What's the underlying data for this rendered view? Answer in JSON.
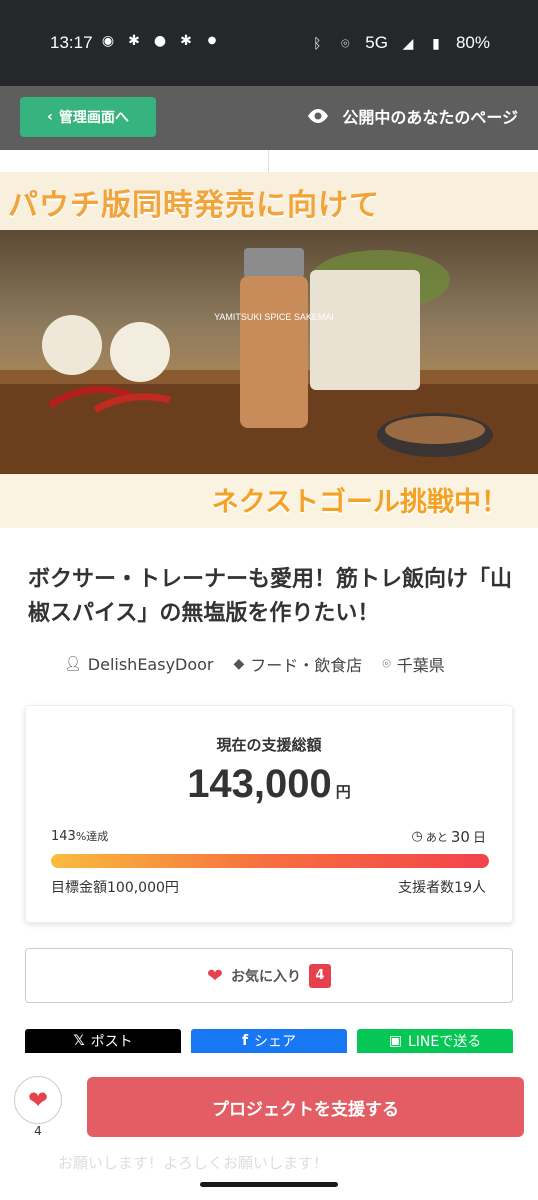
{
  "status_bar": {
    "time": "13:17",
    "network": "5G",
    "battery": "80%"
  },
  "header": {
    "admin_button": "管理画面へ",
    "public_page_link": "公開中のあなたのページ"
  },
  "hero": {
    "top_caption": "パウチ版同時発売に向けて",
    "bottom_caption": "ネクストゴール挑戦中！",
    "jar_label": "YAMITSUKI SPICE SAKEMAI"
  },
  "project": {
    "title": "ボクサー・トレーナーも愛用！筋トレ飯向け「山椒スパイス」の無塩版を作りたい！",
    "owner": "DelishEasyDoor",
    "category": "フード・飲食店",
    "location": "千葉県"
  },
  "funding": {
    "label": "現在の支援総額",
    "amount": "143,000",
    "unit": "円",
    "percent": "143",
    "percent_suffix": "%達成",
    "days_prefix": "あと",
    "days": "30",
    "days_suffix": "日",
    "goal": "目標金額100,000円",
    "backers": "支援者数19人",
    "progress_fraction": 1.0
  },
  "favorite": {
    "label": "お気に入り",
    "count": "4"
  },
  "share": {
    "x_label": "ポスト",
    "facebook_label": "シェア",
    "line_label": "LINEで送る"
  },
  "bottom": {
    "like_count": "4",
    "support_button": "プロジェクトを支援する",
    "behind_text": "お願いします！よろしくお願いします！"
  },
  "colors": {
    "accent_green": "#36b37e",
    "support_red": "#e35d65",
    "heart_red": "#e5424d"
  }
}
